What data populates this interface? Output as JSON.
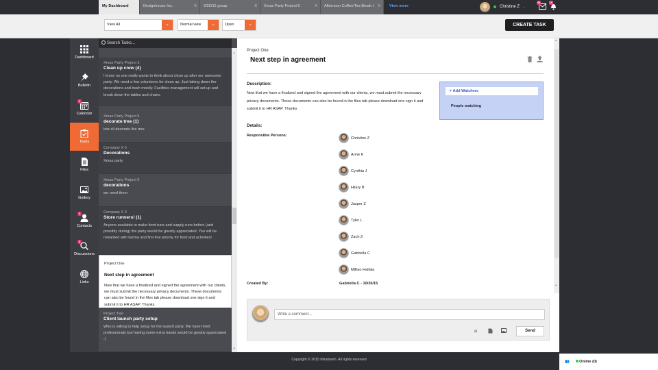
{
  "tabs": [
    {
      "label": "My Dashboard",
      "active": true
    },
    {
      "label": "Designhouse Inc."
    },
    {
      "label": "9/20/15 group"
    },
    {
      "label": "Xmas Party Project 5"
    },
    {
      "label": "Afternoon Coffee/Tea Break t"
    }
  ],
  "tab_close": "X",
  "view_more": "View more",
  "user": {
    "name": "Christine Z",
    "mail_count": "49",
    "notif_count": "10"
  },
  "toolbar": {
    "filter1": "View All",
    "filter2": "Normal view",
    "filter3": "Open",
    "create": "CREATE TASK"
  },
  "nav": [
    {
      "label": "Dashboard",
      "icon": "grid-icon"
    },
    {
      "label": "Bulletin",
      "icon": "pin-icon"
    },
    {
      "label": "Calendar",
      "icon": "calendar-icon",
      "badge": "3"
    },
    {
      "label": "Tasks",
      "icon": "clipboard-icon",
      "active": true
    },
    {
      "label": "Files",
      "icon": "file-icon"
    },
    {
      "label": "Gallery",
      "icon": "gallery-icon"
    },
    {
      "label": "Contacts",
      "icon": "contacts-icon",
      "badge": "3"
    },
    {
      "label": "Discussions",
      "icon": "discussion-icon",
      "badge": "3"
    },
    {
      "label": "Links",
      "icon": "globe-icon"
    }
  ],
  "search_placeholder": "Search Tasks...",
  "tasks": [
    {
      "project": "Xmas Party Project 3",
      "title": "Clean up crew (4)",
      "desc": "I know no one really wants to think about clean up after our awesome party. We need a few volunteers for clean up. Just taking down the decorations and trash mostly. Facilities management will set up and break down the tables and chairs."
    },
    {
      "project": "Xmas Party Project 5",
      "title": "decorate tree (1)",
      "desc": "lets all decorate the tree"
    },
    {
      "project": "Company X 5",
      "title": "Decorations",
      "desc": "Xmas party"
    },
    {
      "project": "Xmas Party Project 5",
      "title": "decorations",
      "desc": "we need them"
    },
    {
      "project": "Company X 3",
      "title": "Store runners! (1)",
      "desc": "Anyone available to make food runs and supply runs before (and possibly during) the party would be greatly appreciated. You will be rewarded with karma and first line priority for food and activities!"
    },
    {
      "project": "Project One",
      "title": "Next step in agreement",
      "desc": "Now that we have a finalized and signed the agreement with our clients, we must submit the necessary privacy documents. These documents can also be found in the files tab please download one sign it and submit it to HR ASAP. Thanks",
      "selected": true
    },
    {
      "project": "Project Two",
      "title": "Client launch party setup",
      "desc": "Who is willing to help setup for the launch party. We have hired professionals but having some extra hands would be greatly appreciated :)"
    }
  ],
  "detail": {
    "project": "Project One",
    "title": "Next step in agreement",
    "desc_label": "Description:",
    "description": "Now that we have a finalized and signed the agreement with our clients, we must submit the necessary privacy documents. These documents can also be found in the files tab please download one sign it and submit it to HR ASAP. Thanks",
    "details_label": "Details:",
    "responsible_label": "Responsible Persons:",
    "persons": [
      "Christine Z",
      "Anne K",
      "Cynthia J",
      "Hilary B",
      "Jasper Z",
      "Tyler L",
      "Zach Z",
      "Gabriella C",
      "Milliso Hallala"
    ],
    "created_label": "Created By:",
    "created_value": "Gabriella C - 10/26/15",
    "add_watchers": "+ Add Watchers",
    "people_watching": "People watching",
    "comment_placeholder": "Write a comment...",
    "send": "Send"
  },
  "footer": "Copyright © 2015 Intraboom. All rights reserved",
  "online": "Online (0)"
}
